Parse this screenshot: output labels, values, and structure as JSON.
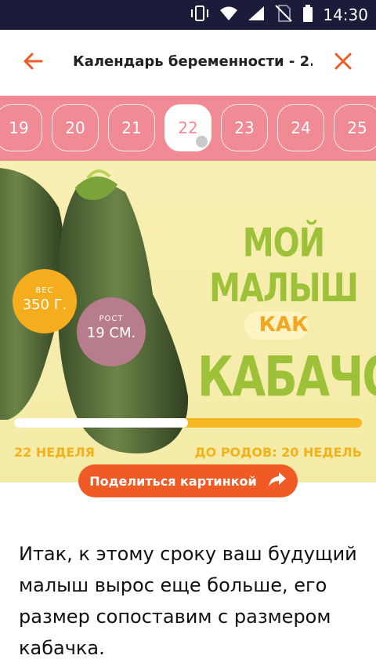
{
  "status_bar": {
    "time": "14:30",
    "icons": [
      "vibrate-icon",
      "wifi-icon",
      "signal-icon",
      "no-sim-icon",
      "battery-icon"
    ]
  },
  "app_bar": {
    "title": "Календарь беременности - 2...",
    "back_icon": "arrow-left-icon",
    "close_icon": "close-icon"
  },
  "weeks": {
    "items": [
      "19",
      "20",
      "21",
      "22",
      "23",
      "24",
      "25"
    ],
    "selected": "22"
  },
  "hero": {
    "headline_line1": "МОЙ МАЛЫШ",
    "headline_line2": "КАК",
    "headline_line3": "КАБАЧОК",
    "weight_label": "ВЕС",
    "weight_value": "350 Г.",
    "height_label": "РОСТ",
    "height_value": "19 СМ.",
    "progress_fraction": 0.5,
    "week_label": "22 НЕДЕЛЯ",
    "remaining_label": "ДО РОДОВ: 20 НЕДЕЛЬ"
  },
  "share_button": {
    "label": "Поделиться картинкой",
    "icon": "share-arrow-icon"
  },
  "body": {
    "text": "Итак, к этому сроку ваш будущий малыш вырос еще больше, его размер сопоставим с размером кабачка."
  },
  "colors": {
    "accent": "#f05a24",
    "week_strip": "#f08a94",
    "hero_bg": "#f8efb2",
    "headline_green": "#9ec13a",
    "headline_orange": "#f4a720",
    "progress_track": "#f6b820",
    "weight_badge": "#f6ad1d",
    "height_badge": "#b87d8c",
    "status_bar": "#1b1b3a"
  }
}
